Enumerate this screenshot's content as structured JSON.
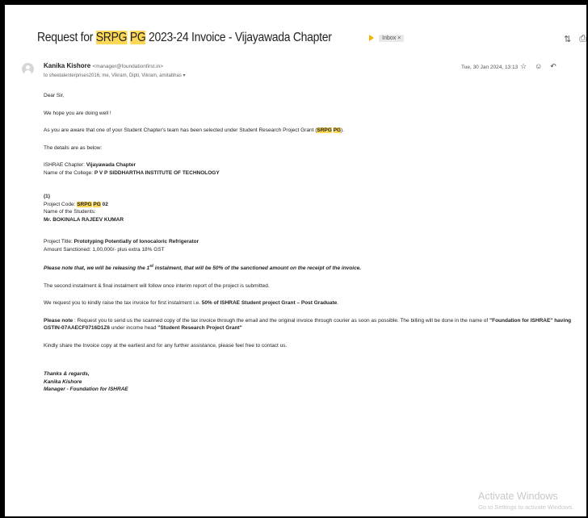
{
  "email": {
    "subject_pre": "Request for ",
    "subject_h1": "SRPG",
    "subject_sp": " ",
    "subject_h2": "PG",
    "subject_post": " 2023-24 Invoice - Vijayawada Chapter",
    "label": "Inbox ×",
    "sender_name": "Kanika Kishore",
    "sender_email": "<manager@foundationfirst.in>",
    "recipients": "to sheetalenterprises2016, me, Vikram, Dipti, Vikram, amitabhas",
    "date": "Tue, 30 Jan 2024, 13:13"
  },
  "icons": {
    "expand": "expand-icon",
    "print": "print-icon",
    "star": "star-icon",
    "emoji": "emoji-icon",
    "reply": "reply-icon"
  },
  "body": {
    "greeting": "Dear Sir,",
    "hope": "We hope you are doing well !",
    "aware_pre": "As you are aware that one of your Student Chapter's team has been selected under Student Research Project Grant (",
    "aware_h1": "SRPG",
    "aware_h2": "PG",
    "aware_post": ").",
    "details": "The details are as below:",
    "chapter_label": "ISHRAE Chapter: ",
    "chapter_value": "Vijayawada Chapter",
    "college_label": "Name of the College: ",
    "college_value": "P V P SIDDHARTHA INSTITUTE OF TECHNOLOGY",
    "item_no": "(1)",
    "code_label": "Project Code: ",
    "code_h1": "SRPG",
    "code_h2": "PG",
    "code_num": " 02",
    "students_label": "Name of the Students:",
    "student_name": "Mr. BOKINALA RAJEEV KUMAR",
    "title_label": "Project Title: ",
    "title_value": "Prototyping Potentially of Ionocaloric Refrigerator",
    "amount": "Amount Sanctioned: 1,00,000/- plus extra 18% GST",
    "release_pre": "Please note that, we will be releasing the 1",
    "release_sup": "st",
    "release_post": " instalment, that will be 50% of the sanctioned amount on the receipt of the invoice.",
    "second": "The second instalment & final instalment will follow once interim report of the project is submitted.",
    "request_pre": "We request you to kindly raise the tax invoice for first instalment i.e. ",
    "request_bold": "50% of ISHRAE Student project Grant – Post Graduate",
    "request_post": ".",
    "note_label": "Please note",
    "note_text": " : Request you to send us the scanned copy of the tax invoice through the email and the original invoice through courier as soon as possible. The billing will be done in the name of ",
    "note_bold1": "\"Foundation for ISHRAE\" having GSTIN-07AAECF0716D1Z6",
    "note_mid": " under income head ",
    "note_bold2": "\"Student Research Project Grant\"",
    "share": "Kindly share the Invoice copy at the earliest and for any further assistance, please feel free to contact us.",
    "thanks": "Thanks & regards,",
    "sig_name": "Kanika Kishore",
    "sig_role": "Manager - Foundation for ISHRAE"
  },
  "watermark": {
    "line1": "Activate Windows",
    "line2": "Go to Settings to activate Windows."
  }
}
